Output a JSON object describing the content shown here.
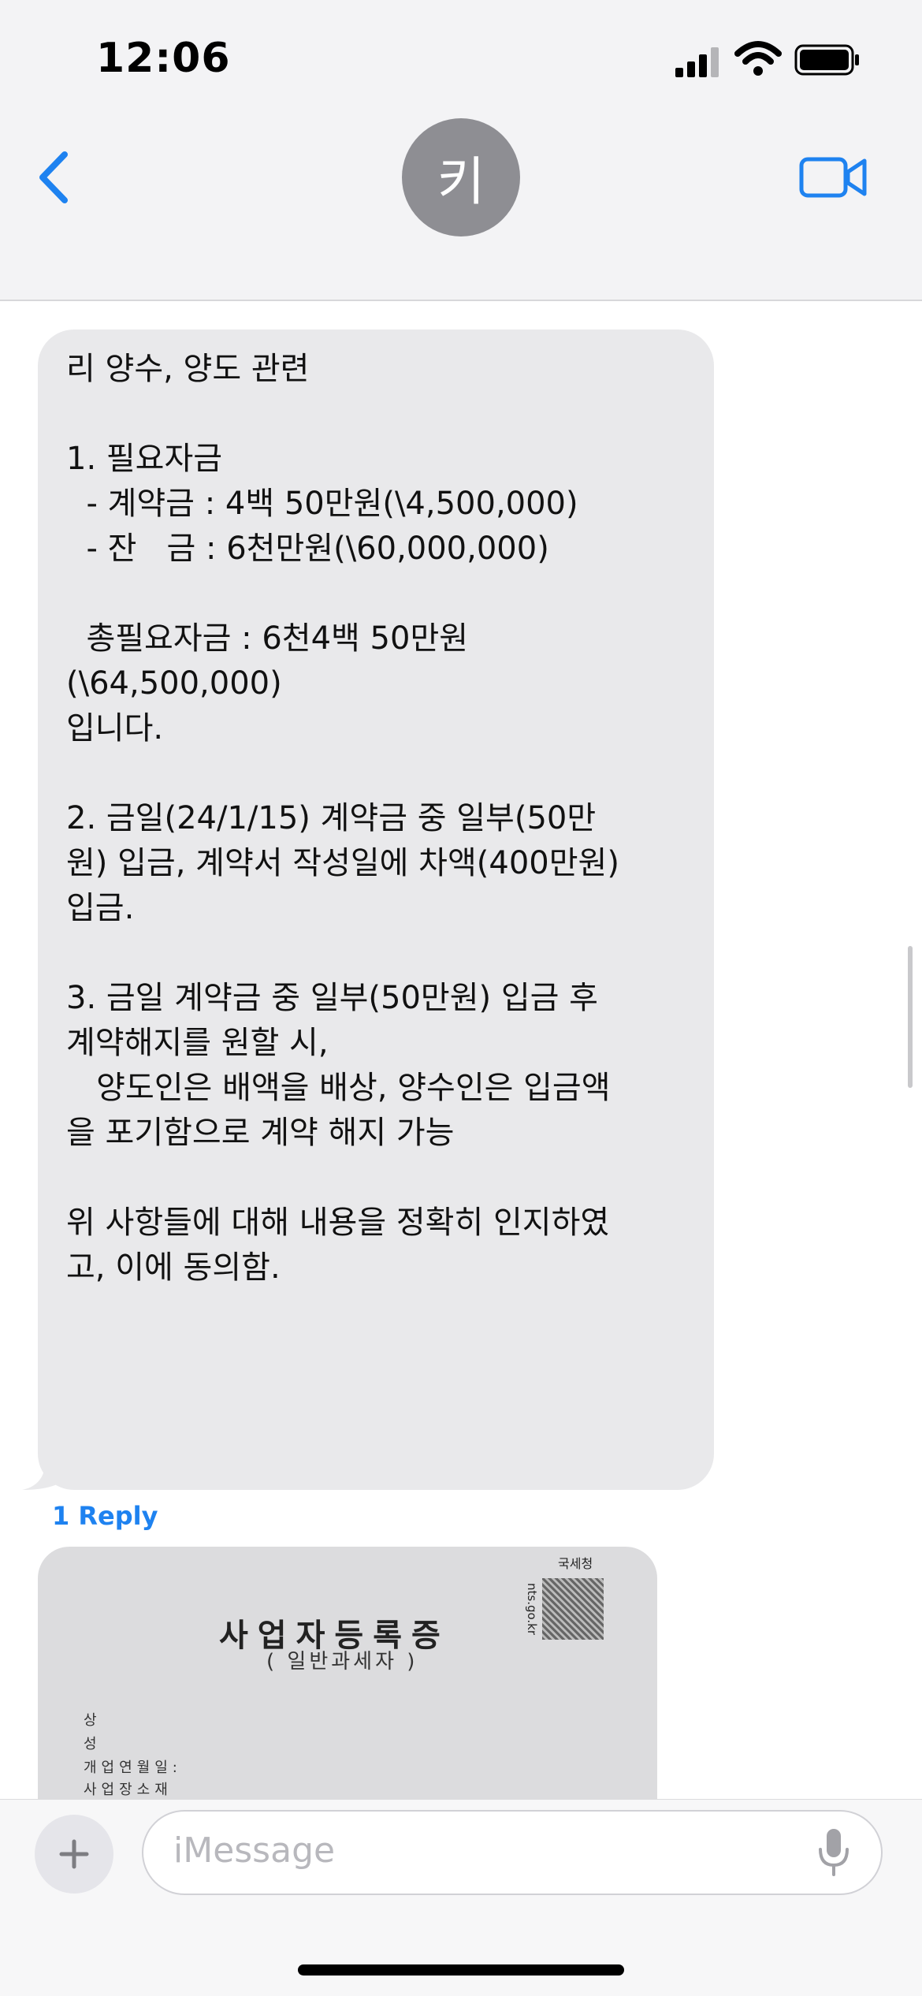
{
  "status_bar": {
    "time": "12:06"
  },
  "header": {
    "avatar_initial": "키",
    "contact_name": ""
  },
  "messages": [
    {
      "text_lines": [
        "리 양수, 양도 관련",
        "",
        "1. 필요자금",
        "  - 계약금 : 4백 50만원(\\4,500,000)",
        "  - 잔   금 : 6천만원(\\60,000,000)",
        "",
        "  총필요자금 : 6천4백 50만원",
        "(\\64,500,000)",
        "입니다.",
        "",
        "2. 금일(24/1/15) 계약금 중 일부(50만",
        "원) 입금, 계약서 작성일에 차액(400만원)",
        "입금.",
        "",
        "3. 금일 계약금 중 일부(50만원) 입금 후",
        "계약해지를 원할 시,",
        "   양도인은 배액을 배상, 양수인은 입금액",
        "을 포기함으로 계약 해지 가능",
        "",
        "위 사항들에 대해 내용을 정확히 인지하였",
        "고, 이에 동의함."
      ],
      "reply_label": "1 Reply"
    }
  ],
  "photo": {
    "agency": "국세청",
    "site": "nts.go.kr",
    "title": "사업자등록증",
    "subtitle": "( 일반과세자 )",
    "rows": [
      "상",
      "성",
      "개업연월일:",
      "사업장소재"
    ]
  },
  "input": {
    "placeholder": "iMessage"
  },
  "colors": {
    "accent": "#1e82f0",
    "bubble": "#e9e9eb",
    "header_bg": "#f3f3f5"
  }
}
